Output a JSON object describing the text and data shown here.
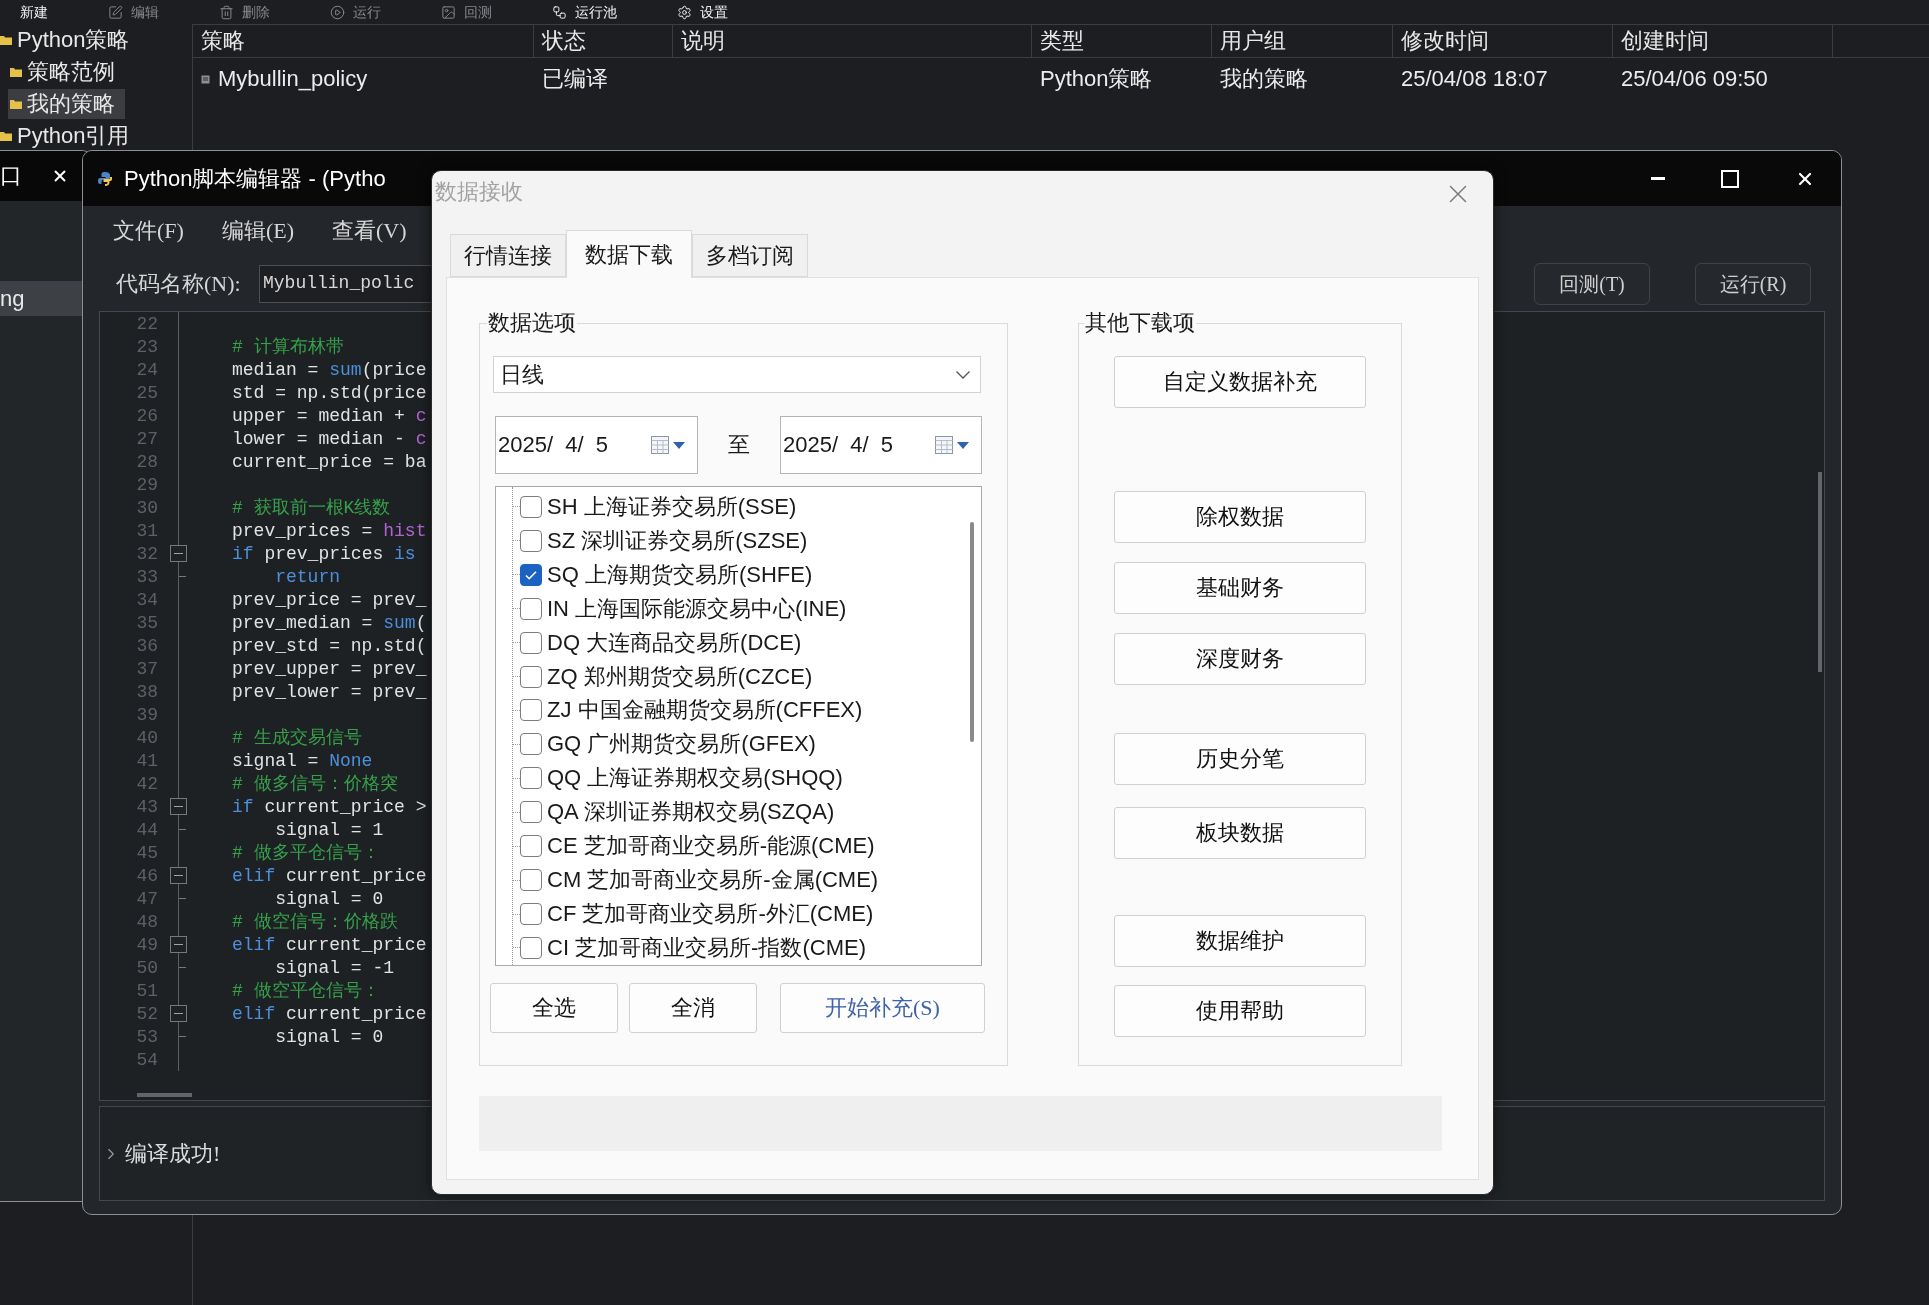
{
  "toolbar": [
    {
      "label": "新建",
      "disabled": false
    },
    {
      "label": "编辑",
      "disabled": true
    },
    {
      "label": "删除",
      "disabled": true
    },
    {
      "label": "运行",
      "disabled": true
    },
    {
      "label": "回测",
      "disabled": true
    },
    {
      "label": "运行池",
      "disabled": false
    },
    {
      "label": "设置",
      "disabled": false
    }
  ],
  "tree": [
    {
      "label": "Python策略",
      "selected": false,
      "children": [
        {
          "label": "策略范例",
          "selected": false
        },
        {
          "label": "我的策略",
          "selected": true
        }
      ]
    },
    {
      "label": "Python引用",
      "selected": false
    }
  ],
  "table": {
    "columns": [
      "策略",
      "状态",
      "说明",
      "类型",
      "用户组",
      "修改时间",
      "创建时间"
    ],
    "rows": [
      {
        "cells": [
          "Mybullin_policy",
          "已编译",
          null,
          "Python策略",
          "我的策略",
          "25/04/08 18:07",
          "25/04/06 09:50"
        ]
      }
    ]
  },
  "back_window": {
    "title": "口",
    "items": [
      {
        "label": "ng",
        "selected": true
      }
    ]
  },
  "editor": {
    "title": "Python脚本编辑器 - (Pytho",
    "menus": [
      "文件(F)",
      "编辑(E)",
      "查看(V)"
    ],
    "code_name": {
      "label": "代码名称(N):",
      "value": "Mybullin_polic"
    },
    "buttons": [
      "回测(T)",
      "运行(R)"
    ],
    "code_lines": [
      {
        "number": "22",
        "kind": "line"
      },
      {
        "number": "23",
        "kind": "line",
        "tokens": [
          {
            "text": "# 计算布林带",
            "kind": "comment"
          }
        ]
      },
      {
        "number": "24",
        "kind": "line",
        "tokens": [
          {
            "text": "median = ",
            "kind": "plain"
          },
          {
            "text": "sum",
            "kind": "builtin"
          },
          {
            "text": "(price",
            "kind": "plain"
          }
        ]
      },
      {
        "number": "25",
        "kind": "line",
        "tokens": [
          {
            "text": "std = np.std(price",
            "kind": "plain"
          }
        ]
      },
      {
        "number": "26",
        "kind": "line",
        "tokens": [
          {
            "text": "upper = median + ",
            "kind": "plain"
          },
          {
            "text": "c",
            "kind": "name"
          }
        ]
      },
      {
        "number": "27",
        "kind": "line",
        "tokens": [
          {
            "text": "lower = median - ",
            "kind": "plain"
          },
          {
            "text": "c",
            "kind": "name"
          }
        ]
      },
      {
        "number": "28",
        "kind": "line",
        "tokens": [
          {
            "text": "current_price = ba",
            "kind": "plain"
          }
        ]
      },
      {
        "number": "29",
        "kind": "line"
      },
      {
        "number": "30",
        "kind": "line",
        "tokens": [
          {
            "text": "# 获取前一根K线数",
            "kind": "comment"
          }
        ]
      },
      {
        "number": "31",
        "kind": "line",
        "tokens": [
          {
            "text": "prev_prices = ",
            "kind": "plain"
          },
          {
            "text": "hist",
            "kind": "name"
          }
        ]
      },
      {
        "number": "32",
        "kind": "fold_start",
        "tokens": [
          {
            "text": "if",
            "kind": "keyword"
          },
          {
            "text": " prev_prices ",
            "kind": "plain"
          },
          {
            "text": "is",
            "kind": "keyword"
          }
        ]
      },
      {
        "number": "33",
        "kind": "fold_end",
        "tokens": [
          {
            "text": "    return",
            "kind": "keyword"
          }
        ]
      },
      {
        "number": "34",
        "kind": "line",
        "tokens": [
          {
            "text": "prev_price = prev_",
            "kind": "plain"
          }
        ]
      },
      {
        "number": "35",
        "kind": "line",
        "tokens": [
          {
            "text": "prev_median = ",
            "kind": "plain"
          },
          {
            "text": "sum",
            "kind": "builtin"
          },
          {
            "text": "(",
            "kind": "plain"
          }
        ]
      },
      {
        "number": "36",
        "kind": "line",
        "tokens": [
          {
            "text": "prev_std = np.std(",
            "kind": "plain"
          }
        ]
      },
      {
        "number": "37",
        "kind": "line",
        "tokens": [
          {
            "text": "prev_upper = prev_",
            "kind": "plain"
          }
        ]
      },
      {
        "number": "38",
        "kind": "line",
        "tokens": [
          {
            "text": "prev_lower = prev_",
            "kind": "plain"
          }
        ]
      },
      {
        "number": "39",
        "kind": "line"
      },
      {
        "number": "40",
        "kind": "line",
        "tokens": [
          {
            "text": "# 生成交易信号",
            "kind": "comment"
          }
        ]
      },
      {
        "number": "41",
        "kind": "line",
        "tokens": [
          {
            "text": "signal = ",
            "kind": "plain"
          },
          {
            "text": "None",
            "kind": "keyword"
          }
        ]
      },
      {
        "number": "42",
        "kind": "line",
        "tokens": [
          {
            "text": "# 做多信号：价格突",
            "kind": "comment"
          }
        ]
      },
      {
        "number": "43",
        "kind": "fold_start",
        "tokens": [
          {
            "text": "if",
            "kind": "keyword"
          },
          {
            "text": " current_price >",
            "kind": "plain"
          }
        ]
      },
      {
        "number": "44",
        "kind": "fold_end",
        "tokens": [
          {
            "text": "    signal = 1",
            "kind": "plain"
          }
        ]
      },
      {
        "number": "45",
        "kind": "line",
        "tokens": [
          {
            "text": "# 做多平仓信号：",
            "kind": "comment"
          }
        ]
      },
      {
        "number": "46",
        "kind": "fold_start",
        "tokens": [
          {
            "text": "elif",
            "kind": "keyword"
          },
          {
            "text": " current_price",
            "kind": "plain"
          }
        ]
      },
      {
        "number": "47",
        "kind": "fold_end",
        "tokens": [
          {
            "text": "    signal = 0",
            "kind": "plain"
          }
        ]
      },
      {
        "number": "48",
        "kind": "line",
        "tokens": [
          {
            "text": "# 做空信号：价格跌",
            "kind": "comment"
          }
        ]
      },
      {
        "number": "49",
        "kind": "fold_start",
        "tokens": [
          {
            "text": "elif",
            "kind": "keyword"
          },
          {
            "text": " current_price",
            "kind": "plain"
          }
        ]
      },
      {
        "number": "50",
        "kind": "fold_end",
        "tokens": [
          {
            "text": "    signal = -1",
            "kind": "plain"
          }
        ]
      },
      {
        "number": "51",
        "kind": "line",
        "tokens": [
          {
            "text": "# 做空平仓信号：",
            "kind": "comment"
          }
        ]
      },
      {
        "number": "52",
        "kind": "fold_start",
        "tokens": [
          {
            "text": "elif",
            "kind": "keyword"
          },
          {
            "text": " current_price",
            "kind": "plain"
          }
        ]
      },
      {
        "number": "53",
        "kind": "fold_end",
        "tokens": [
          {
            "text": "    signal = 0",
            "kind": "plain"
          }
        ]
      },
      {
        "number": "54",
        "kind": "line"
      }
    ],
    "output": "编译成功!"
  },
  "dialog": {
    "title": "数据接收",
    "tabs": [
      {
        "label": "行情连接",
        "selected": false
      },
      {
        "label": "数据下载",
        "selected": true
      },
      {
        "label": "多档订阅",
        "selected": false
      }
    ],
    "data_options": {
      "title": "数据选项",
      "period": "日线",
      "start_date": "2025/  4/  5",
      "to_label": "至",
      "end_date": "2025/  4/  5",
      "exchanges": [
        {
          "label": "SH 上海证券交易所(SSE)",
          "checked": false
        },
        {
          "label": "SZ 深圳证券交易所(SZSE)",
          "checked": false
        },
        {
          "label": "SQ 上海期货交易所(SHFE)",
          "checked": true
        },
        {
          "label": "IN 上海国际能源交易中心(INE)",
          "checked": false
        },
        {
          "label": "DQ 大连商品交易所(DCE)",
          "checked": false
        },
        {
          "label": "ZQ 郑州期货交易所(CZCE)",
          "checked": false
        },
        {
          "label": "ZJ 中国金融期货交易所(CFFEX)",
          "checked": false
        },
        {
          "label": "GQ 广州期货交易所(GFEX)",
          "checked": false
        },
        {
          "label": "QQ 上海证券期权交易(SHQQ)",
          "checked": false
        },
        {
          "label": "QA 深圳证券期权交易(SZQA)",
          "checked": false
        },
        {
          "label": "CE 芝加哥商业交易所-能源(CME)",
          "checked": false
        },
        {
          "label": "CM 芝加哥商业交易所-金属(CME)",
          "checked": false
        },
        {
          "label": "CF 芝加哥商业交易所-外汇(CME)",
          "checked": false
        },
        {
          "label": "CI 芝加哥商业交易所-指数(CME)",
          "checked": false
        }
      ],
      "buttons": [
        {
          "label": "全选",
          "kind": "plain"
        },
        {
          "label": "全消",
          "kind": "plain"
        },
        {
          "label": "开始补充(S)",
          "kind": "action"
        }
      ]
    },
    "other_downloads": {
      "title": "其他下载项",
      "button_groups": [
        [
          "自定义数据补充"
        ],
        [
          "除权数据",
          "基础财务",
          "深度财务"
        ],
        [
          "历史分笔",
          "板块数据"
        ],
        [
          "数据维护",
          "使用帮助"
        ]
      ]
    }
  }
}
